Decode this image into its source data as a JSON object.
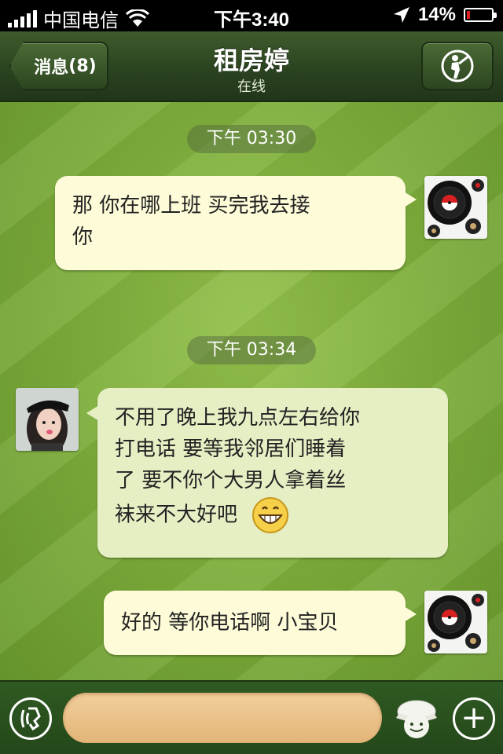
{
  "status_bar": {
    "carrier": "中国电信",
    "time": "下午3:40",
    "battery_percent": "14%",
    "battery_level": 0.14,
    "icons": [
      "signal-icon",
      "wifi-icon",
      "location-arrow-icon",
      "battery-icon"
    ]
  },
  "nav": {
    "back_label": "消息",
    "unread_count": "(8)",
    "title": "租房婷",
    "subtitle": "在线",
    "profile_icon": "golfer-icon"
  },
  "messages": [
    {
      "type": "timestamp",
      "text": "下午 03:30"
    },
    {
      "type": "message",
      "side": "right",
      "lines": [
        "那 你在哪上班 买完我去接",
        "你"
      ],
      "avatar": "vinyl-record-avatar"
    },
    {
      "type": "timestamp",
      "text": "下午 03:34"
    },
    {
      "type": "message",
      "side": "left",
      "lines": [
        "不用了晚上我九点左右给你",
        "打电话  要等我邻居们睡着",
        "了  要不你个大男人拿着丝",
        "袜来不大好吧"
      ],
      "emoji": "grin-emoji",
      "avatar": "contact-photo-avatar"
    },
    {
      "type": "message",
      "side": "right",
      "lines": [
        "好的 等你电话啊 小宝贝"
      ],
      "avatar": "vinyl-record-avatar"
    }
  ],
  "input_bar": {
    "message_value": "",
    "icons": [
      "voice-icon",
      "emoji-cap-icon",
      "plus-icon"
    ]
  },
  "colors": {
    "nav_green": "#2b4320",
    "chat_green": "#7faf3c",
    "bubble_sent": "#fdfbd8",
    "bubble_received": "#e6efc4",
    "input_tan": "#e2b578"
  }
}
